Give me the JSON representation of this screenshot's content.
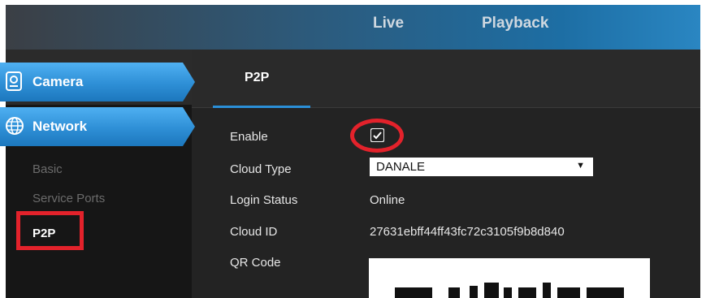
{
  "topnav": {
    "items": [
      {
        "label": "Live"
      },
      {
        "label": "Playback"
      }
    ]
  },
  "tabs": {
    "active": "P2P"
  },
  "sidebar": {
    "menu": [
      {
        "label": "Camera",
        "icon": "camera-icon"
      },
      {
        "label": "Network",
        "icon": "network-globe-icon"
      }
    ],
    "submenu": [
      {
        "label": "Basic"
      },
      {
        "label": "Service Ports"
      },
      {
        "label": "P2P",
        "selected": true
      }
    ]
  },
  "form": {
    "enable_label": "Enable",
    "enable_checked": true,
    "cloud_type_label": "Cloud Type",
    "cloud_type_value": "DANALE",
    "login_status_label": "Login Status",
    "login_status_value": "Online",
    "cloud_id_label": "Cloud ID",
    "cloud_id_value": "27631ebff44ff43fc72c3105f9b8d840",
    "qr_code_label": "QR Code"
  },
  "colors": {
    "accent_blue": "#2e8fd6",
    "highlight_red": "#e3222b"
  }
}
